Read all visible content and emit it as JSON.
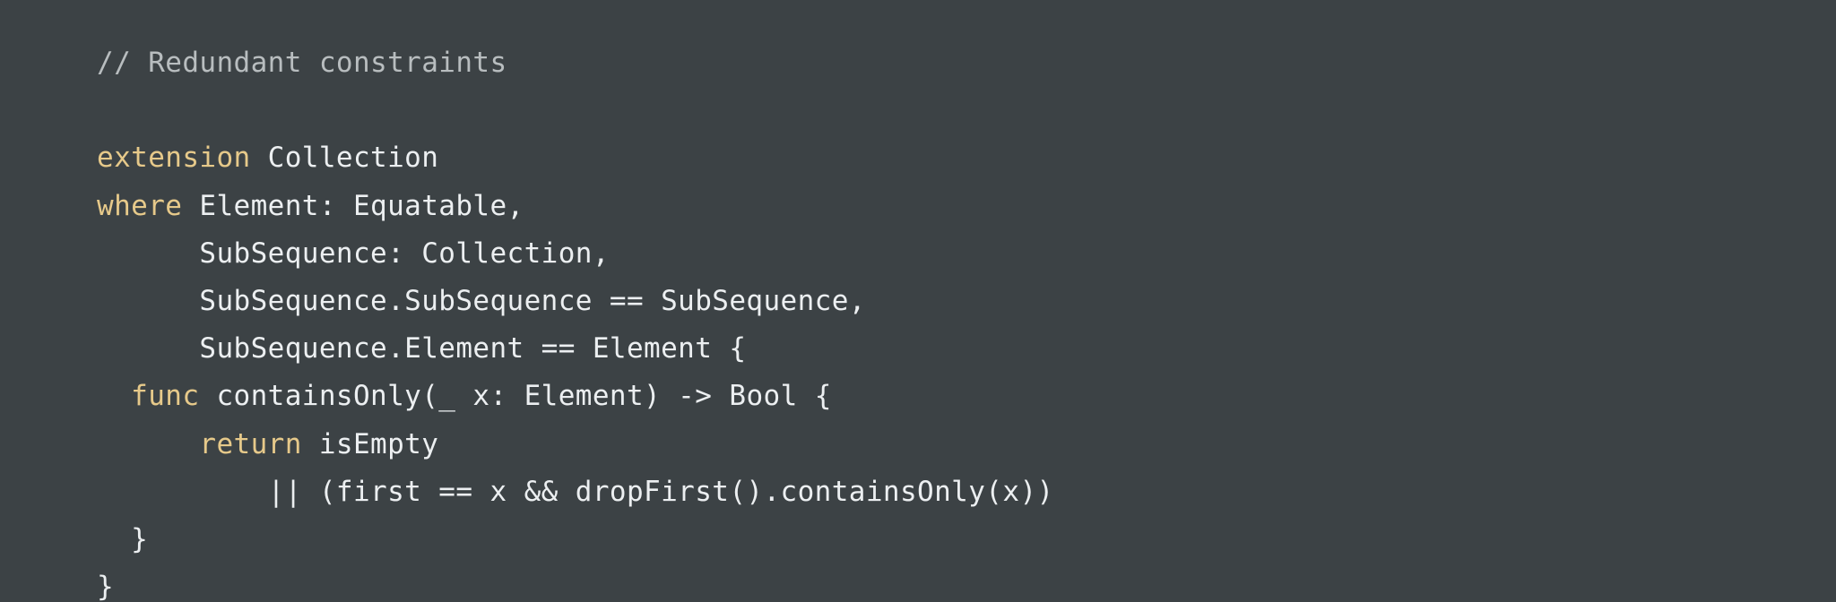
{
  "code": {
    "lines": [
      {
        "indent": "",
        "tokens": [
          {
            "text": "// Redundant constraints",
            "kind": "comment"
          }
        ]
      },
      {
        "indent": "",
        "tokens": []
      },
      {
        "indent": "",
        "tokens": [
          {
            "text": "extension",
            "kind": "keyword"
          },
          {
            "text": " Collection",
            "kind": "plain"
          }
        ]
      },
      {
        "indent": "",
        "tokens": [
          {
            "text": "where",
            "kind": "keyword"
          },
          {
            "text": " Element: Equatable,",
            "kind": "plain"
          }
        ]
      },
      {
        "indent": "      ",
        "tokens": [
          {
            "text": "SubSequence: Collection,",
            "kind": "plain"
          }
        ]
      },
      {
        "indent": "      ",
        "tokens": [
          {
            "text": "SubSequence.SubSequence == SubSequence,",
            "kind": "plain"
          }
        ]
      },
      {
        "indent": "      ",
        "tokens": [
          {
            "text": "SubSequence.Element == Element {",
            "kind": "plain"
          }
        ]
      },
      {
        "indent": "  ",
        "tokens": [
          {
            "text": "func",
            "kind": "keyword"
          },
          {
            "text": " containsOnly(_ x: Element) -> Bool {",
            "kind": "plain"
          }
        ]
      },
      {
        "indent": "      ",
        "tokens": [
          {
            "text": "return",
            "kind": "keyword"
          },
          {
            "text": " isEmpty",
            "kind": "plain"
          }
        ]
      },
      {
        "indent": "          ",
        "tokens": [
          {
            "text": "|| (first == x && dropFirst().containsOnly(x))",
            "kind": "plain"
          }
        ]
      },
      {
        "indent": "  ",
        "tokens": [
          {
            "text": "}",
            "kind": "plain"
          }
        ]
      },
      {
        "indent": "",
        "tokens": [
          {
            "text": "}",
            "kind": "plain"
          }
        ]
      }
    ]
  },
  "colors": {
    "background": "#3c4245",
    "keyword": "#e6c98a",
    "comment": "#b8bdbf",
    "plain": "#eceff1"
  }
}
